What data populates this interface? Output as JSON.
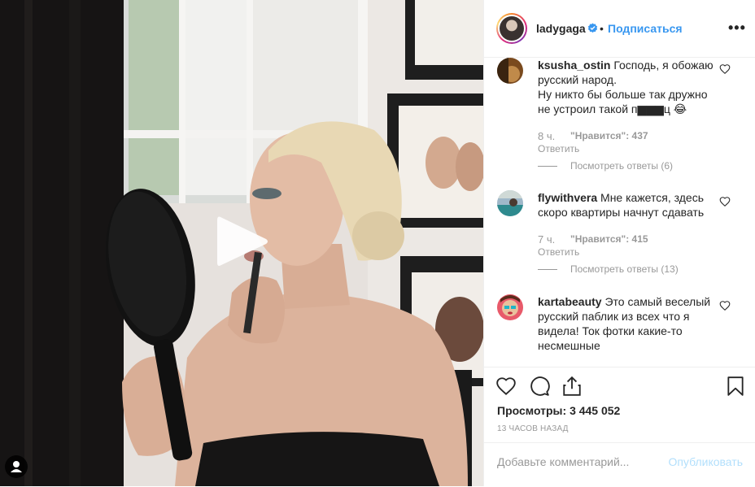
{
  "header": {
    "username": "ladygaga",
    "dot": "•",
    "follow_label": "Подписаться",
    "more_label": "•••"
  },
  "comments": [
    {
      "username": "ksusha_ostin",
      "lines": [
        "Господь, я обожаю",
        "русский народ.",
        "Ну никто бы больше так дружно",
        "не устроил такой п▆▆▆ц 😂"
      ],
      "time": "8 ч.",
      "likes_label": "\"Нравится\": 437",
      "reply_label": "Ответить",
      "view_replies": "Посмотреть ответы (6)"
    },
    {
      "username": "flywithvera",
      "lines": [
        "Мне кажется, здесь",
        "скоро квартиры начнут сдавать"
      ],
      "time": "7 ч.",
      "likes_label": "\"Нравится\": 415",
      "reply_label": "Ответить",
      "view_replies": "Посмотреть ответы (13)"
    },
    {
      "username": "kartabeauty",
      "lines": [
        "Это самый веселый",
        "русский паблик из всех что я",
        "видела! Ток фотки какие-то",
        "несмешные"
      ]
    }
  ],
  "stats": {
    "views_label": "Просмотры:",
    "views_count": "3 445 052",
    "time_ago": "13 ЧАСОВ НАЗАД"
  },
  "add_comment": {
    "placeholder": "Добавьте комментарий...",
    "publish_label": "Опубликовать"
  },
  "colors": {
    "accent": "#3897f0",
    "publish_disabled": "#b2dffc",
    "text": "#262626",
    "muted": "#999999",
    "border": "#efefef"
  },
  "icons": {
    "verified": "verified-badge-icon",
    "play": "play-icon",
    "user_tag": "user-tag-icon",
    "heart": "heart-icon",
    "comment": "comment-icon",
    "share": "share-icon",
    "save": "bookmark-icon"
  }
}
